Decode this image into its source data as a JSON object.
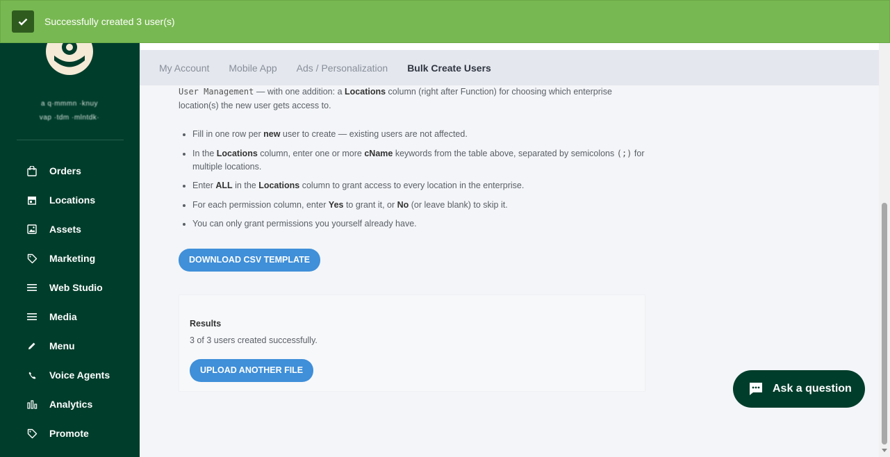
{
  "toast": {
    "message": "Successfully created 3 user(s)",
    "color": "#78b852"
  },
  "sidebar": {
    "org_name_line1": "a q·mmmn ·knuy",
    "org_name_line2": "vap ·tdm ·mlntdk·",
    "items": [
      {
        "label": "Orders",
        "icon": "shopping-bag-icon"
      },
      {
        "label": "Locations",
        "icon": "store-icon"
      },
      {
        "label": "Assets",
        "icon": "image-icon"
      },
      {
        "label": "Marketing",
        "icon": "tag-icon"
      },
      {
        "label": "Web Studio",
        "icon": "menu-lines-icon"
      },
      {
        "label": "Media",
        "icon": "menu-lines-icon"
      },
      {
        "label": "Menu",
        "icon": "pencil-icon"
      },
      {
        "label": "Voice Agents",
        "icon": "phone-icon"
      },
      {
        "label": "Analytics",
        "icon": "bar-chart-icon"
      },
      {
        "label": "Promote",
        "icon": "tag-icon"
      }
    ],
    "bg_color": "#003d2b"
  },
  "tabs": [
    {
      "label": "My Account",
      "active": false
    },
    {
      "label": "Mobile App",
      "active": false
    },
    {
      "label": "Ads / Personalization",
      "active": false
    },
    {
      "label": "Bulk Create Users",
      "active": true
    }
  ],
  "content": {
    "intro_code": "User Management",
    "intro_a": " — with one addition: a ",
    "intro_b": "Locations",
    "intro_c": " column (right after Function) for choosing which enterprise location(s) the new user gets access to.",
    "b1_a": "Fill in one row per ",
    "b1_b": "new",
    "b1_c": " user to create — existing users are not affected.",
    "b2_a": "In the ",
    "b2_b": "Locations",
    "b2_c": " column, enter one or more ",
    "b2_d": "cName",
    "b2_e": " keywords from the table above, separated by semicolons ",
    "b2_f": "(;)",
    "b2_g": " for multiple locations.",
    "b3_a": "Enter ",
    "b3_b": "ALL",
    "b3_c": " in the ",
    "b3_d": "Locations",
    "b3_e": " column to grant access to every location in the enterprise.",
    "b4_a": "For each permission column, enter ",
    "b4_b": "Yes",
    "b4_c": " to grant it, or ",
    "b4_d": "No",
    "b4_e": " (or leave blank) to skip it.",
    "b5": "You can only grant permissions you yourself already have.",
    "download_label": "DOWNLOAD CSV TEMPLATE"
  },
  "results": {
    "title": "Results",
    "text": "3 of 3 users created successfully.",
    "upload_label": "UPLOAD ANOTHER FILE"
  },
  "ask": {
    "label": "Ask a question"
  },
  "colors": {
    "accent": "#3f8fd9",
    "brand": "#003d2b"
  }
}
